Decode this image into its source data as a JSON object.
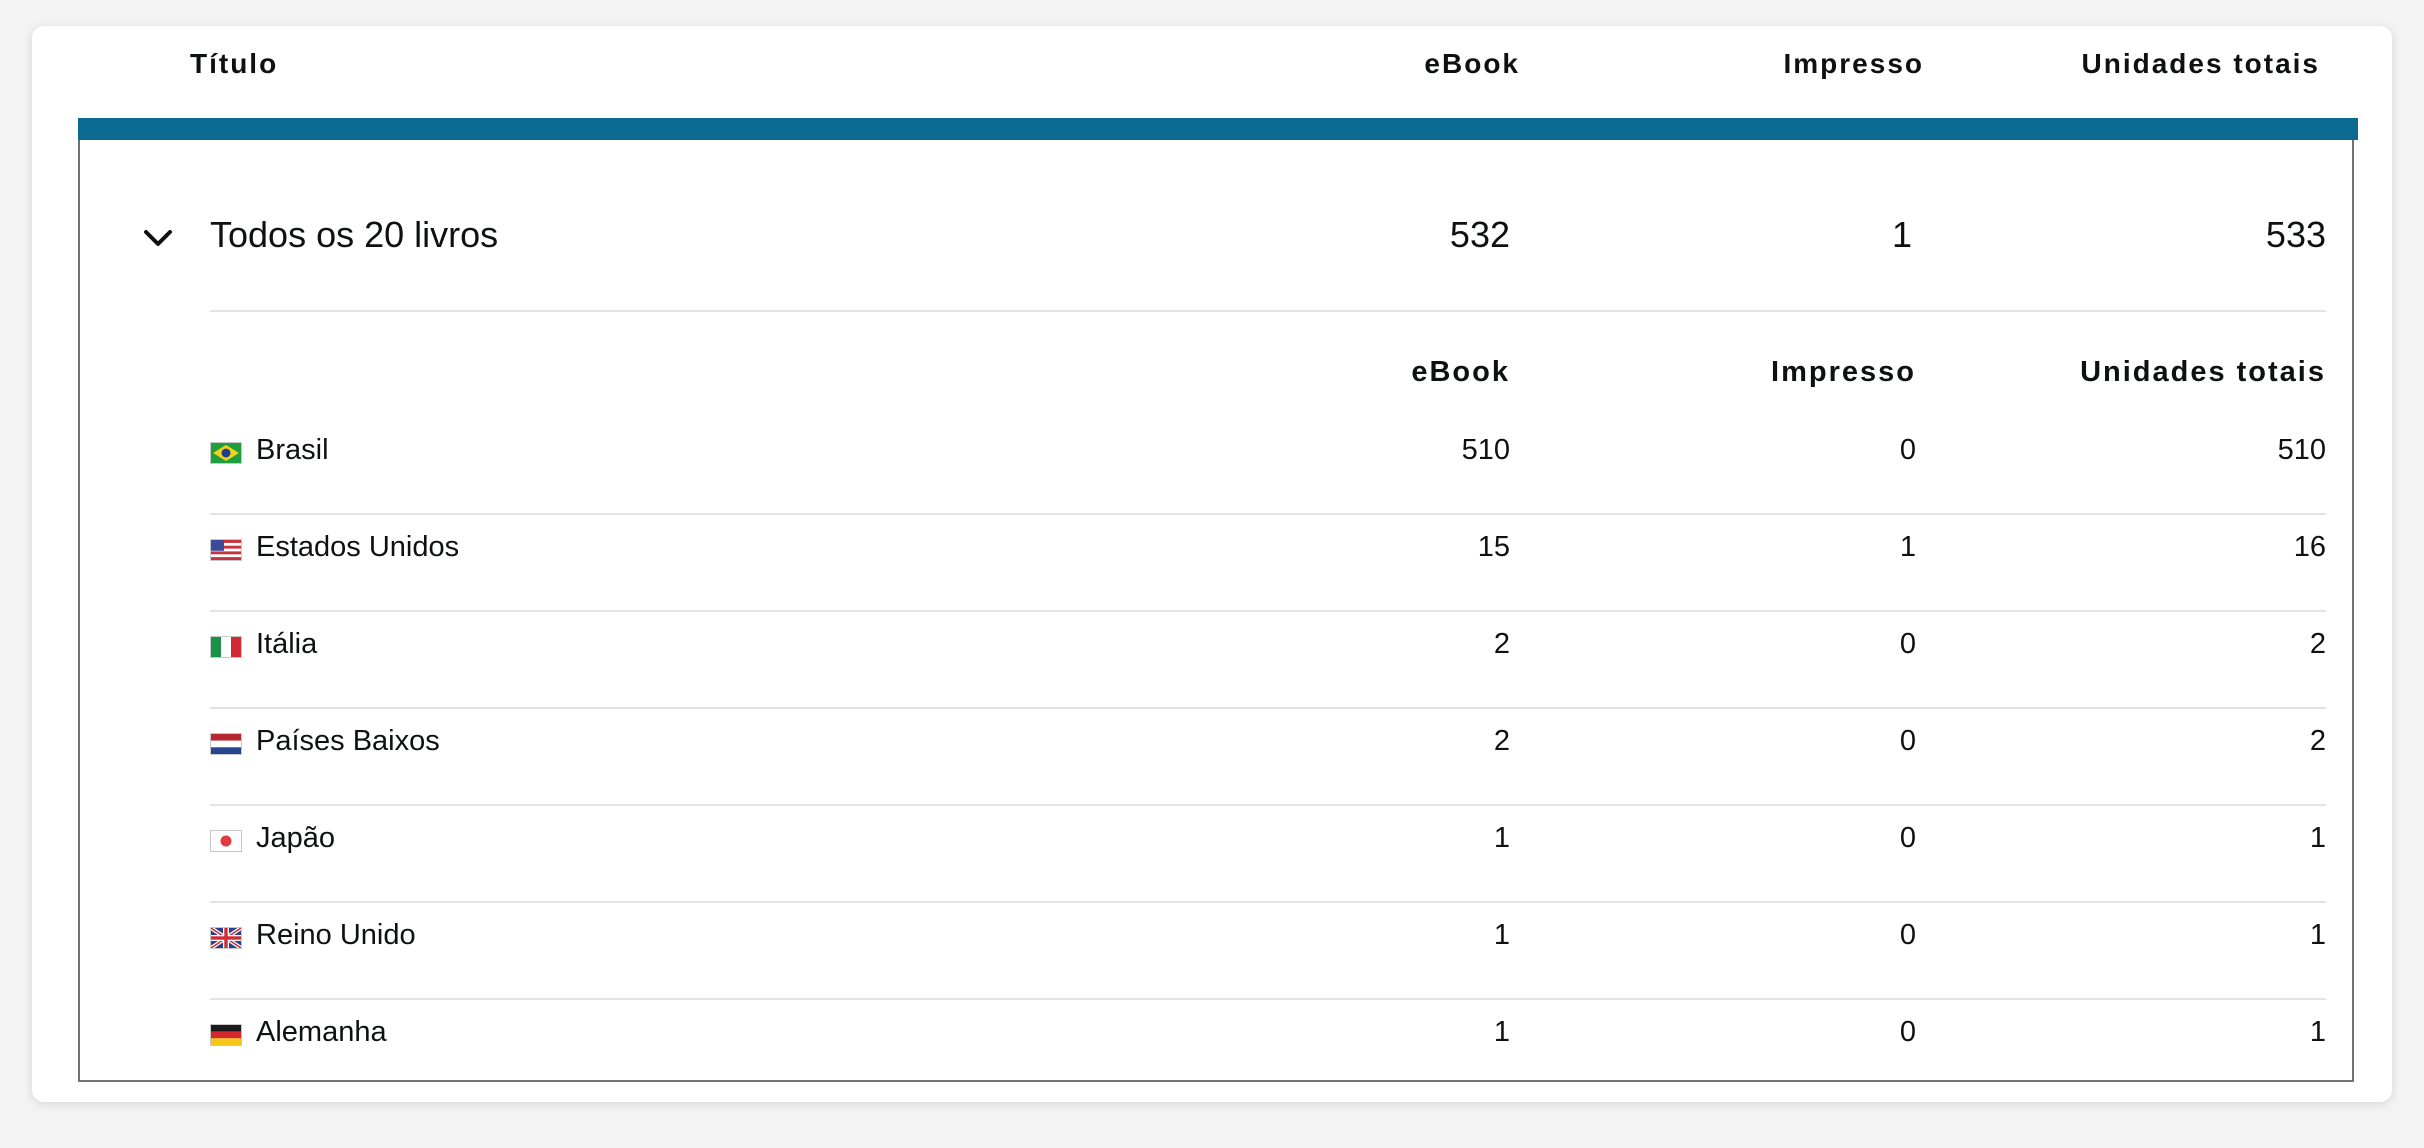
{
  "header": {
    "title_col": "Título",
    "ebook_col": "eBook",
    "impresso_col": "Impresso",
    "total_col": "Unidades totais"
  },
  "summary": {
    "label": "Todos os 20 livros",
    "ebook": "532",
    "impresso": "1",
    "total": "533",
    "expand_icon": "chevron-down-icon"
  },
  "subheader": {
    "ebook_col": "eBook",
    "impresso_col": "Impresso",
    "total_col": "Unidades totais"
  },
  "colors": {
    "accent": "#0b6a90",
    "divider": "#e3e3e3",
    "text": "#0f1111"
  },
  "rows": [
    {
      "country": "Brasil",
      "flag": "flag-brazil-icon",
      "ebook": "510",
      "impresso": "0",
      "total": "510"
    },
    {
      "country": "Estados Unidos",
      "flag": "flag-usa-icon",
      "ebook": "15",
      "impresso": "1",
      "total": "16"
    },
    {
      "country": "Itália",
      "flag": "flag-italy-icon",
      "ebook": "2",
      "impresso": "0",
      "total": "2"
    },
    {
      "country": "Países Baixos",
      "flag": "flag-netherlands-icon",
      "ebook": "2",
      "impresso": "0",
      "total": "2"
    },
    {
      "country": "Japão",
      "flag": "flag-japan-icon",
      "ebook": "1",
      "impresso": "0",
      "total": "1"
    },
    {
      "country": "Reino Unido",
      "flag": "flag-uk-icon",
      "ebook": "1",
      "impresso": "0",
      "total": "1"
    },
    {
      "country": "Alemanha",
      "flag": "flag-germany-icon",
      "ebook": "1",
      "impresso": "0",
      "total": "1"
    }
  ]
}
